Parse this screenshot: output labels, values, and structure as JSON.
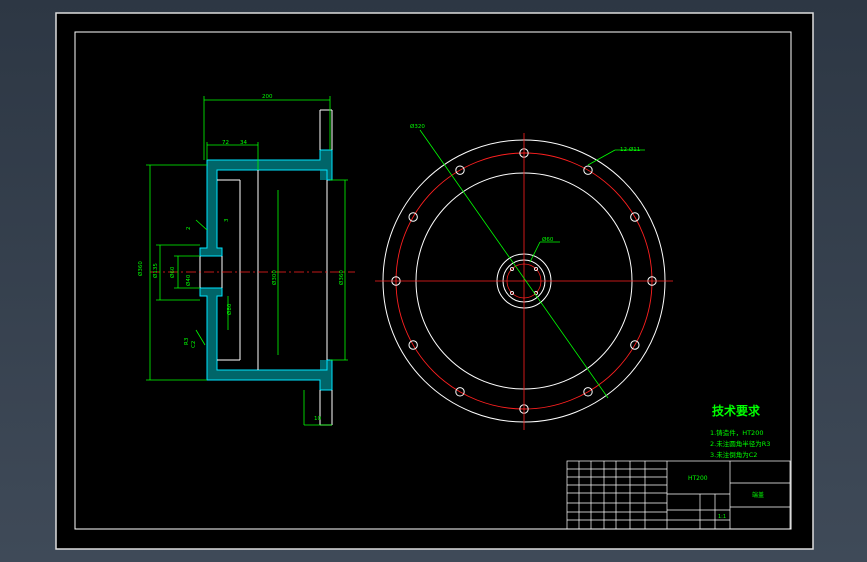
{
  "drawing": {
    "tech_title": "技术要求",
    "notes": [
      "1.铸造件，HT200",
      "2.未注圆角半径为R3",
      "3.未注倒角为C2"
    ],
    "labels": {
      "top_dim": "200",
      "sec_dim1": "72",
      "sec_dim2": "34",
      "left_dim": "Ø360",
      "left_inner": "Ø135",
      "hub_dim": "Ø60",
      "hub_small": "Ø40",
      "bore_dim": "Ø80",
      "mid_dim": "Ø300",
      "right_dim": "Ø360",
      "bottom_dim": "10",
      "small_a": "R3",
      "small_b": "C2",
      "small_c": "2",
      "small_d": "3",
      "pcd": "Ø320",
      "holes": "12-Ø11",
      "center_hole": "Ø60",
      "material": "HT200",
      "part_name": "端盖",
      "scale": "1:1"
    },
    "colors": {
      "outline": "#ffffff",
      "dim": "#00ff00",
      "center": "#ff2020",
      "hatch": "#00cccc",
      "background": "#000000"
    }
  }
}
